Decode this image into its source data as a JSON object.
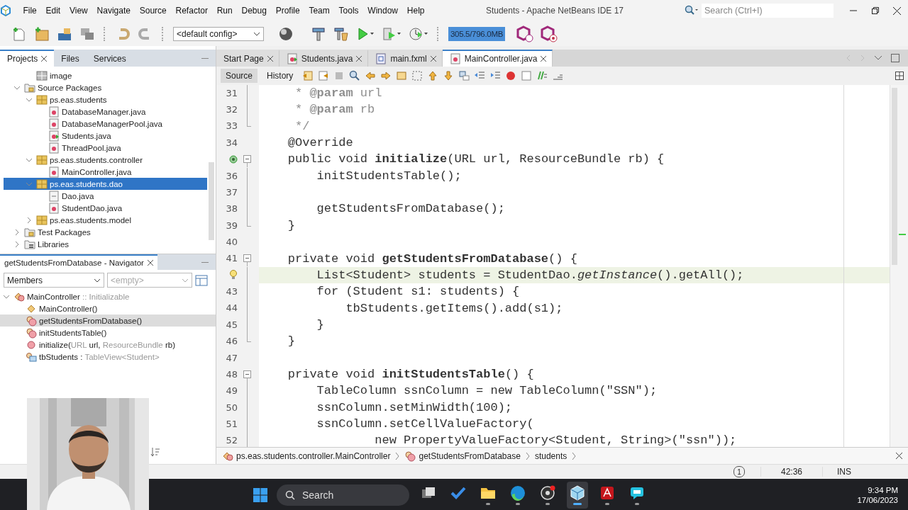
{
  "title_bar": {
    "menu": [
      "File",
      "Edit",
      "View",
      "Navigate",
      "Source",
      "Refactor",
      "Run",
      "Debug",
      "Profile",
      "Team",
      "Tools",
      "Window",
      "Help"
    ],
    "title": "Students - Apache NetBeans IDE 17",
    "search": {
      "placeholder": "Search (Ctrl+I)"
    }
  },
  "toolbar": {
    "config": "<default config>",
    "memory": "305.5/796.0MB"
  },
  "projects": {
    "tabs": [
      {
        "label": "Projects",
        "selected": true
      },
      {
        "label": "Files",
        "selected": false
      },
      {
        "label": "Services",
        "selected": false
      }
    ],
    "tree": [
      {
        "kind": "hidden_parent",
        "children": [
          {
            "label": "image",
            "kind": "image_folder",
            "selected": false
          }
        ]
      },
      {
        "label": "Source Packages",
        "kind": "source_folder",
        "expanded": true,
        "selected": false,
        "children": [
          {
            "label": "ps.eas.students",
            "kind": "package",
            "expanded": true,
            "selected": false,
            "children": [
              {
                "label": "DatabaseManager.java",
                "kind": "java",
                "selected": false
              },
              {
                "label": "DatabaseManagerPool.java",
                "kind": "java",
                "selected": false
              },
              {
                "label": "Students.java",
                "kind": "java_main",
                "selected": false
              },
              {
                "label": "ThreadPool.java",
                "kind": "java",
                "selected": false
              }
            ]
          },
          {
            "label": "ps.eas.students.controller",
            "kind": "package",
            "expanded": true,
            "selected": false,
            "children": [
              {
                "label": "MainController.java",
                "kind": "java_form",
                "selected": false
              }
            ]
          },
          {
            "label": "ps.eas.students.dao",
            "kind": "package",
            "expanded": true,
            "selected": true,
            "children": [
              {
                "label": "Dao.java",
                "kind": "java_interface",
                "selected": false
              },
              {
                "label": "StudentDao.java",
                "kind": "java",
                "selected": false
              }
            ]
          },
          {
            "label": "ps.eas.students.model",
            "kind": "package",
            "expanded": false,
            "selected": false
          }
        ]
      },
      {
        "label": "Test Packages",
        "kind": "test_folder",
        "expanded": false,
        "selected": false
      },
      {
        "label": "Libraries",
        "kind": "libraries",
        "expanded": false,
        "selected": false
      }
    ]
  },
  "navigator": {
    "title": "getStudentsFromDatabase - Navigator",
    "filter": "Members",
    "secondary_filter": "<empty>",
    "tree": [
      {
        "kind": "class",
        "expanded": true,
        "selected": false,
        "parts": [
          {
            "text": "MainController",
            "muted": false
          },
          {
            "text": " :: Initializable",
            "muted": true
          }
        ],
        "children": [
          {
            "kind": "constructor",
            "selected": false,
            "parts": [
              {
                "text": "MainController()",
                "muted": false
              }
            ]
          },
          {
            "kind": "private_method",
            "selected": true,
            "parts": [
              {
                "text": "getStudentsFromDatabase()",
                "muted": false
              }
            ]
          },
          {
            "kind": "private_method",
            "selected": false,
            "parts": [
              {
                "text": "initStudentsTable()",
                "muted": false
              }
            ]
          },
          {
            "kind": "public_method",
            "selected": false,
            "parts": [
              {
                "text": "initialize(",
                "muted": false
              },
              {
                "text": "URL",
                "muted": true
              },
              {
                "text": " url, ",
                "muted": false
              },
              {
                "text": "ResourceBundle",
                "muted": true
              },
              {
                "text": " rb)",
                "muted": false
              }
            ]
          },
          {
            "kind": "field",
            "selected": false,
            "parts": [
              {
                "text": "tbStudents : ",
                "muted": false
              },
              {
                "text": "TableView<Student>",
                "muted": true
              }
            ]
          }
        ]
      }
    ]
  },
  "editor": {
    "tabs": [
      {
        "label": "Start Page",
        "kind": "page",
        "selected": false
      },
      {
        "label": "Students.java",
        "kind": "java_main",
        "selected": false
      },
      {
        "label": "main.fxml",
        "kind": "fxml",
        "selected": false
      },
      {
        "label": "MainController.java",
        "kind": "java_form",
        "selected": true
      }
    ],
    "views": [
      {
        "label": "Source",
        "selected": true
      },
      {
        "label": "History",
        "selected": false
      }
    ],
    "lines": [
      {
        "number": "31",
        "fold": {
          "kind": "guide"
        },
        "current": false,
        "kind": "comment",
        "text": "     * **@param** url"
      },
      {
        "number": "32",
        "fold": {
          "kind": "guide"
        },
        "current": false,
        "kind": "comment",
        "text": "     * **@param** rb"
      },
      {
        "number": "33",
        "fold": {
          "kind": "end"
        },
        "current": false,
        "kind": "comment",
        "text": "     */"
      },
      {
        "number": "34",
        "current": false,
        "kind": "code",
        "text": "    @Override"
      },
      {
        "marker": {
          "kind": "override"
        },
        "fold": {
          "kind": "toggle"
        },
        "current": false,
        "kind": "code",
        "text": "    public void **initialize**(URL url, ResourceBundle rb) {"
      },
      {
        "number": "36",
        "fold": {
          "kind": "guide"
        },
        "current": false,
        "kind": "code",
        "text": "        initStudentsTable();"
      },
      {
        "number": "37",
        "fold": {
          "kind": "guide"
        },
        "current": false
      },
      {
        "number": "38",
        "fold": {
          "kind": "guide"
        },
        "current": false,
        "kind": "code",
        "text": "        getStudentsFromDatabase();"
      },
      {
        "number": "39",
        "fold": {
          "kind": "end"
        },
        "current": false,
        "kind": "code",
        "text": "    }"
      },
      {
        "number": "40",
        "current": false
      },
      {
        "number": "41",
        "fold": {
          "kind": "toggle"
        },
        "current": false,
        "kind": "code",
        "text": "    private void **getStudentsFromDatabase**() {"
      },
      {
        "marker": {
          "kind": "bulb"
        },
        "fold": {
          "kind": "guide"
        },
        "current": true,
        "kind": "code",
        "text": "        List<Student> students = StudentDao.*getInstance*().getAll();"
      },
      {
        "number": "43",
        "fold": {
          "kind": "guide"
        },
        "current": false,
        "kind": "code",
        "text": "        for (Student s1: students) {"
      },
      {
        "number": "44",
        "fold": {
          "kind": "guide"
        },
        "current": false,
        "kind": "code",
        "text": "            tbStudents.getItems().add(s1);"
      },
      {
        "number": "45",
        "fold": {
          "kind": "guide"
        },
        "current": false,
        "kind": "code",
        "text": "        }"
      },
      {
        "number": "46",
        "fold": {
          "kind": "end"
        },
        "current": false,
        "kind": "code",
        "text": "    }"
      },
      {
        "number": "47",
        "current": false
      },
      {
        "number": "48",
        "fold": {
          "kind": "toggle"
        },
        "current": false,
        "kind": "code",
        "text": "    private void **initStudentsTable**() {"
      },
      {
        "number": "49",
        "fold": {
          "kind": "guide"
        },
        "current": false,
        "kind": "code",
        "text": "        TableColumn ssnColumn = new TableColumn(\"SSN\");"
      },
      {
        "number": "50",
        "fold": {
          "kind": "guide"
        },
        "current": false,
        "kind": "code",
        "text": "        ssnColumn.setMinWidth(100);"
      },
      {
        "number": "51",
        "fold": {
          "kind": "guide"
        },
        "current": false,
        "kind": "code",
        "text": "        ssnColumn.setCellValueFactory("
      },
      {
        "number": "52",
        "fold": {
          "kind": "guide"
        },
        "current": false,
        "kind": "code",
        "text": "                new PropertyValueFactory<Student, String>(\"ssn\"));"
      }
    ],
    "breadcrumb": [
      {
        "label": "ps.eas.students.controller.MainController",
        "kind": "class"
      },
      {
        "label": "getStudentsFromDatabase",
        "kind": "method"
      },
      {
        "label": "students",
        "kind": "variable"
      }
    ]
  },
  "status_bar": {
    "notifications": "1",
    "position": "42:36",
    "mode": "INS"
  },
  "taskbar": {
    "search": "Search",
    "time": "9:34 PM",
    "date": "17/06/2023",
    "apps": [
      {
        "kind": "task_view",
        "running": false,
        "selected": false
      },
      {
        "kind": "todo",
        "running": false,
        "selected": false
      },
      {
        "kind": "explorer",
        "running": true,
        "selected": false
      },
      {
        "kind": "edge",
        "running": true,
        "selected": false
      },
      {
        "kind": "recorder",
        "running": true,
        "selected": false
      },
      {
        "kind": "netbeans",
        "running": true,
        "selected": true
      },
      {
        "kind": "pdf",
        "running": true,
        "selected": false
      },
      {
        "kind": "chat",
        "running": true,
        "selected": false
      }
    ]
  }
}
